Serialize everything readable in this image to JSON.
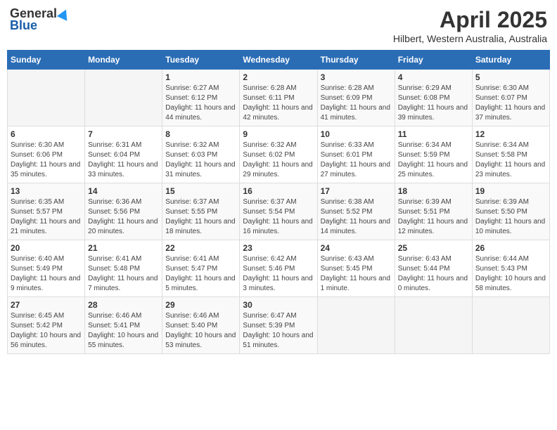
{
  "header": {
    "logo_general": "General",
    "logo_blue": "Blue",
    "title": "April 2025",
    "subtitle": "Hilbert, Western Australia, Australia"
  },
  "days_of_week": [
    "Sunday",
    "Monday",
    "Tuesday",
    "Wednesday",
    "Thursday",
    "Friday",
    "Saturday"
  ],
  "weeks": [
    [
      {
        "day": "",
        "sunrise": "",
        "sunset": "",
        "daylight": "",
        "empty": true
      },
      {
        "day": "",
        "sunrise": "",
        "sunset": "",
        "daylight": "",
        "empty": true
      },
      {
        "day": "1",
        "sunrise": "Sunrise: 6:27 AM",
        "sunset": "Sunset: 6:12 PM",
        "daylight": "Daylight: 11 hours and 44 minutes.",
        "empty": false
      },
      {
        "day": "2",
        "sunrise": "Sunrise: 6:28 AM",
        "sunset": "Sunset: 6:11 PM",
        "daylight": "Daylight: 11 hours and 42 minutes.",
        "empty": false
      },
      {
        "day": "3",
        "sunrise": "Sunrise: 6:28 AM",
        "sunset": "Sunset: 6:09 PM",
        "daylight": "Daylight: 11 hours and 41 minutes.",
        "empty": false
      },
      {
        "day": "4",
        "sunrise": "Sunrise: 6:29 AM",
        "sunset": "Sunset: 6:08 PM",
        "daylight": "Daylight: 11 hours and 39 minutes.",
        "empty": false
      },
      {
        "day": "5",
        "sunrise": "Sunrise: 6:30 AM",
        "sunset": "Sunset: 6:07 PM",
        "daylight": "Daylight: 11 hours and 37 minutes.",
        "empty": false
      }
    ],
    [
      {
        "day": "6",
        "sunrise": "Sunrise: 6:30 AM",
        "sunset": "Sunset: 6:06 PM",
        "daylight": "Daylight: 11 hours and 35 minutes.",
        "empty": false
      },
      {
        "day": "7",
        "sunrise": "Sunrise: 6:31 AM",
        "sunset": "Sunset: 6:04 PM",
        "daylight": "Daylight: 11 hours and 33 minutes.",
        "empty": false
      },
      {
        "day": "8",
        "sunrise": "Sunrise: 6:32 AM",
        "sunset": "Sunset: 6:03 PM",
        "daylight": "Daylight: 11 hours and 31 minutes.",
        "empty": false
      },
      {
        "day": "9",
        "sunrise": "Sunrise: 6:32 AM",
        "sunset": "Sunset: 6:02 PM",
        "daylight": "Daylight: 11 hours and 29 minutes.",
        "empty": false
      },
      {
        "day": "10",
        "sunrise": "Sunrise: 6:33 AM",
        "sunset": "Sunset: 6:01 PM",
        "daylight": "Daylight: 11 hours and 27 minutes.",
        "empty": false
      },
      {
        "day": "11",
        "sunrise": "Sunrise: 6:34 AM",
        "sunset": "Sunset: 5:59 PM",
        "daylight": "Daylight: 11 hours and 25 minutes.",
        "empty": false
      },
      {
        "day": "12",
        "sunrise": "Sunrise: 6:34 AM",
        "sunset": "Sunset: 5:58 PM",
        "daylight": "Daylight: 11 hours and 23 minutes.",
        "empty": false
      }
    ],
    [
      {
        "day": "13",
        "sunrise": "Sunrise: 6:35 AM",
        "sunset": "Sunset: 5:57 PM",
        "daylight": "Daylight: 11 hours and 21 minutes.",
        "empty": false
      },
      {
        "day": "14",
        "sunrise": "Sunrise: 6:36 AM",
        "sunset": "Sunset: 5:56 PM",
        "daylight": "Daylight: 11 hours and 20 minutes.",
        "empty": false
      },
      {
        "day": "15",
        "sunrise": "Sunrise: 6:37 AM",
        "sunset": "Sunset: 5:55 PM",
        "daylight": "Daylight: 11 hours and 18 minutes.",
        "empty": false
      },
      {
        "day": "16",
        "sunrise": "Sunrise: 6:37 AM",
        "sunset": "Sunset: 5:54 PM",
        "daylight": "Daylight: 11 hours and 16 minutes.",
        "empty": false
      },
      {
        "day": "17",
        "sunrise": "Sunrise: 6:38 AM",
        "sunset": "Sunset: 5:52 PM",
        "daylight": "Daylight: 11 hours and 14 minutes.",
        "empty": false
      },
      {
        "day": "18",
        "sunrise": "Sunrise: 6:39 AM",
        "sunset": "Sunset: 5:51 PM",
        "daylight": "Daylight: 11 hours and 12 minutes.",
        "empty": false
      },
      {
        "day": "19",
        "sunrise": "Sunrise: 6:39 AM",
        "sunset": "Sunset: 5:50 PM",
        "daylight": "Daylight: 11 hours and 10 minutes.",
        "empty": false
      }
    ],
    [
      {
        "day": "20",
        "sunrise": "Sunrise: 6:40 AM",
        "sunset": "Sunset: 5:49 PM",
        "daylight": "Daylight: 11 hours and 9 minutes.",
        "empty": false
      },
      {
        "day": "21",
        "sunrise": "Sunrise: 6:41 AM",
        "sunset": "Sunset: 5:48 PM",
        "daylight": "Daylight: 11 hours and 7 minutes.",
        "empty": false
      },
      {
        "day": "22",
        "sunrise": "Sunrise: 6:41 AM",
        "sunset": "Sunset: 5:47 PM",
        "daylight": "Daylight: 11 hours and 5 minutes.",
        "empty": false
      },
      {
        "day": "23",
        "sunrise": "Sunrise: 6:42 AM",
        "sunset": "Sunset: 5:46 PM",
        "daylight": "Daylight: 11 hours and 3 minutes.",
        "empty": false
      },
      {
        "day": "24",
        "sunrise": "Sunrise: 6:43 AM",
        "sunset": "Sunset: 5:45 PM",
        "daylight": "Daylight: 11 hours and 1 minute.",
        "empty": false
      },
      {
        "day": "25",
        "sunrise": "Sunrise: 6:43 AM",
        "sunset": "Sunset: 5:44 PM",
        "daylight": "Daylight: 11 hours and 0 minutes.",
        "empty": false
      },
      {
        "day": "26",
        "sunrise": "Sunrise: 6:44 AM",
        "sunset": "Sunset: 5:43 PM",
        "daylight": "Daylight: 10 hours and 58 minutes.",
        "empty": false
      }
    ],
    [
      {
        "day": "27",
        "sunrise": "Sunrise: 6:45 AM",
        "sunset": "Sunset: 5:42 PM",
        "daylight": "Daylight: 10 hours and 56 minutes.",
        "empty": false
      },
      {
        "day": "28",
        "sunrise": "Sunrise: 6:46 AM",
        "sunset": "Sunset: 5:41 PM",
        "daylight": "Daylight: 10 hours and 55 minutes.",
        "empty": false
      },
      {
        "day": "29",
        "sunrise": "Sunrise: 6:46 AM",
        "sunset": "Sunset: 5:40 PM",
        "daylight": "Daylight: 10 hours and 53 minutes.",
        "empty": false
      },
      {
        "day": "30",
        "sunrise": "Sunrise: 6:47 AM",
        "sunset": "Sunset: 5:39 PM",
        "daylight": "Daylight: 10 hours and 51 minutes.",
        "empty": false
      },
      {
        "day": "",
        "sunrise": "",
        "sunset": "",
        "daylight": "",
        "empty": true
      },
      {
        "day": "",
        "sunrise": "",
        "sunset": "",
        "daylight": "",
        "empty": true
      },
      {
        "day": "",
        "sunrise": "",
        "sunset": "",
        "daylight": "",
        "empty": true
      }
    ]
  ]
}
